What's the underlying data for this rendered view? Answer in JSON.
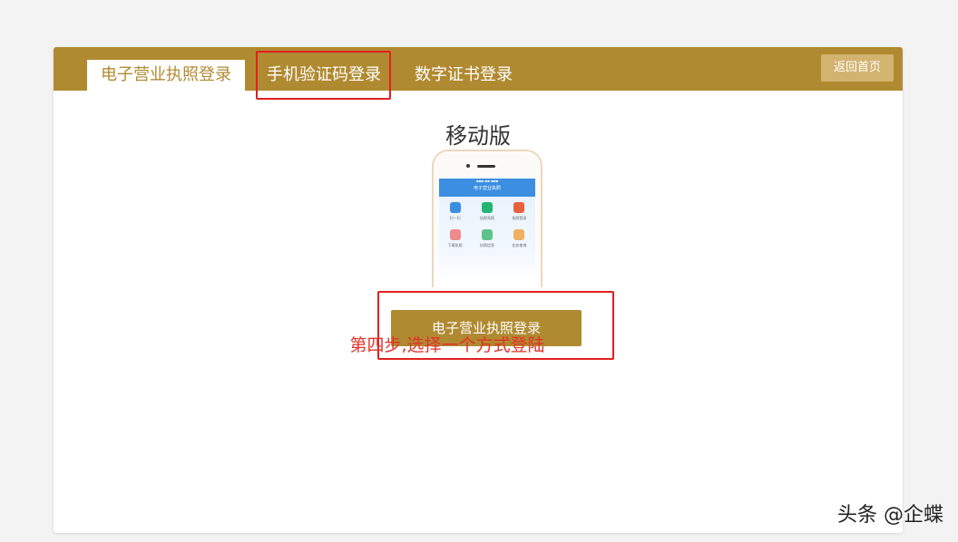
{
  "tabs": [
    {
      "label": "电子营业执照登录",
      "active": true
    },
    {
      "label": "手机验证码登录",
      "active": false
    },
    {
      "label": "数字证书登录",
      "active": false
    }
  ],
  "header": {
    "back_label": "返回首页"
  },
  "main": {
    "title": "移动版",
    "login_button": "电子营业执照登录"
  },
  "phone_app": {
    "header_title": "电子营业执照",
    "apps": [
      {
        "label": "扫一扫",
        "icon": "qr-scan-icon",
        "color": "#3b8ee0"
      },
      {
        "label": "执照亮照",
        "icon": "license-icon",
        "color": "#22b573"
      },
      {
        "label": "执照登录",
        "icon": "seal-icon",
        "color": "#e8603c"
      },
      {
        "label": "下载执照",
        "icon": "download-icon",
        "color": "#f08a8a"
      },
      {
        "label": "执照信息",
        "icon": "info-icon",
        "color": "#5cc48a"
      },
      {
        "label": "业务查询",
        "icon": "query-icon",
        "color": "#f0b060"
      }
    ]
  },
  "annotation": {
    "step_note": "第四步,选择一个方式登陆"
  },
  "watermark": "头条 @企蝶",
  "colors": {
    "brand": "#b08a30",
    "accent_red": "#e02020",
    "back_button": "#d2b36f"
  }
}
